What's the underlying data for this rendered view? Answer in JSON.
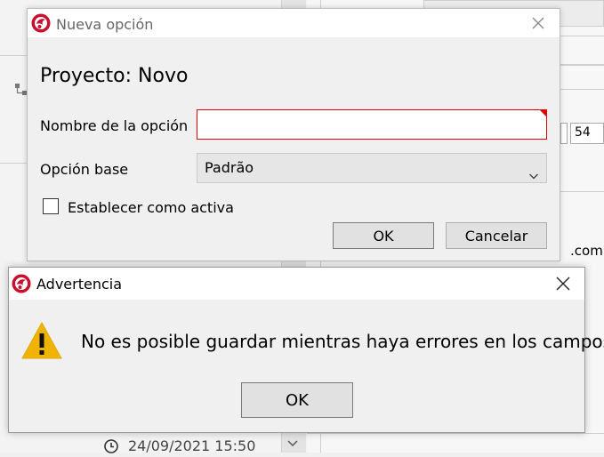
{
  "background": {
    "field_value": "54",
    "email_suffix": ".com",
    "timestamp": "24/09/2021 15:50"
  },
  "new_option_dialog": {
    "title": "Nueva opción",
    "project_heading": "Proyecto: Novo",
    "name_label": "Nombre de la opción",
    "name_value": "",
    "base_label": "Opción base",
    "base_selected": "Padrão",
    "set_active_label": "Establecer como activa",
    "set_active_checked": false,
    "ok_label": "OK",
    "cancel_label": "Cancelar",
    "name_field_error": true
  },
  "warning_dialog": {
    "title": "Advertencia",
    "message": "No es posible guardar mientras haya errores en los campos.",
    "ok_label": "OK"
  },
  "colors": {
    "error_red": "#e00000",
    "warning_yellow": "#f0b400",
    "logo_red": "#c8102e"
  },
  "icons": [
    "app-logo-icon",
    "close-icon",
    "chevron-down-icon",
    "warning-icon",
    "clock-icon",
    "hierarchy-icon"
  ]
}
